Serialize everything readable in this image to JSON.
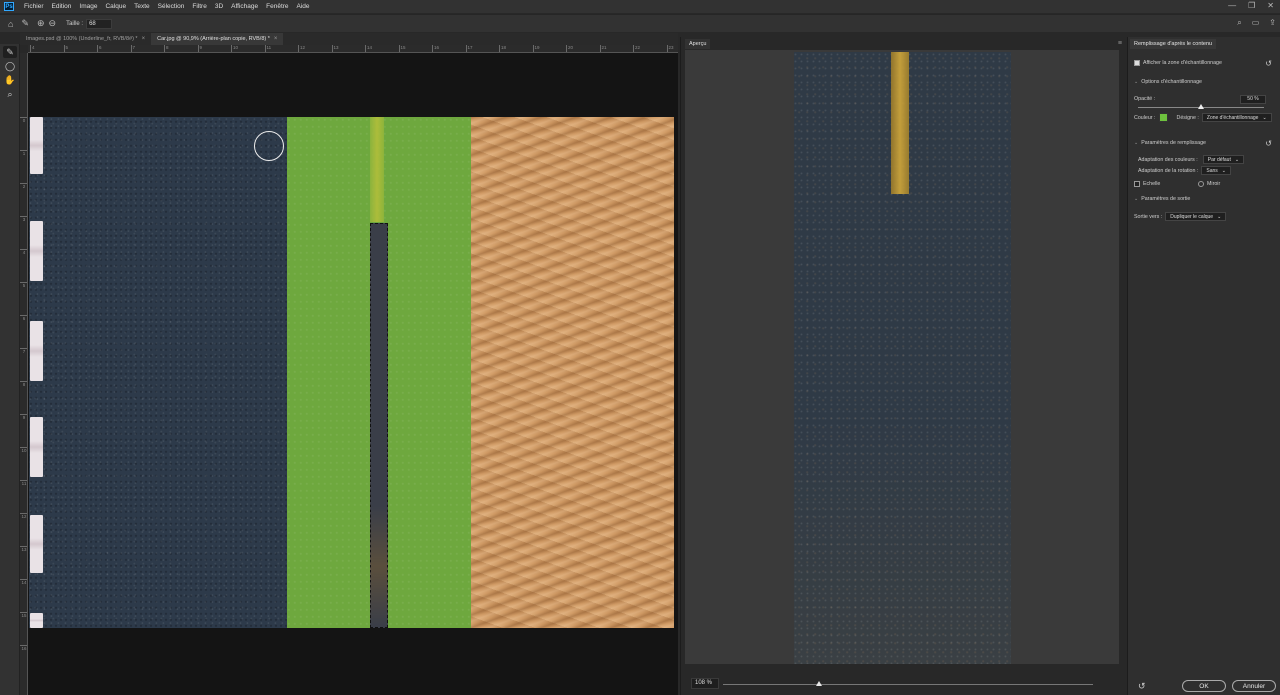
{
  "app": {
    "logo": "Ps"
  },
  "menu": [
    "Fichier",
    "Edition",
    "Image",
    "Calque",
    "Texte",
    "Sélection",
    "Filtre",
    "3D",
    "Affichage",
    "Fenêtre",
    "Aide"
  ],
  "window_controls": {
    "minimize": "—",
    "restore": "❐",
    "close": "✕"
  },
  "options": {
    "size_label": "Taille :",
    "size_value": "68"
  },
  "tools": [
    "brush-icon",
    "lasso-icon",
    "hand-icon",
    "zoom-icon"
  ],
  "tabs": [
    {
      "label": "Images.psd @ 100% (Underline_fr, RVB/8#) *",
      "close": "×",
      "active": false
    },
    {
      "label": "Car.jpg @ 90,9% (Arrière-plan copie, RVB/8) *",
      "close": "×",
      "active": true
    }
  ],
  "ruler_h": [
    "4",
    "5",
    "6",
    "7",
    "8",
    "9",
    "10",
    "11",
    "12",
    "13",
    "14",
    "15",
    "16",
    "17",
    "18",
    "19",
    "20",
    "21",
    "22",
    "23",
    "24",
    "25",
    "26"
  ],
  "ruler_v": [
    "0",
    "1",
    "2",
    "3",
    "4",
    "5",
    "6",
    "7",
    "8",
    "9",
    "10",
    "11",
    "12",
    "13",
    "14",
    "15",
    "16"
  ],
  "preview": {
    "tab": "Aperçu",
    "menu": "≡",
    "zoom": "108 %",
    "zoom_level": 0.26
  },
  "props": {
    "tab": "Remplissage d'après le contenu",
    "show_sampling": "Afficher la zone d'échantillonnage",
    "sampling_options": "Options d'échantillonnage",
    "opacity_label": "Opacité :",
    "opacity_value": "50 %",
    "opacity_level": 0.5,
    "color_label": "Couleur :",
    "color_hex": "#6ec23e",
    "designate_label": "Désigne :",
    "designate_value": "Zone d'échantillonnage",
    "fill_settings": "Paramètres de remplissage",
    "color_adapt_label": "Adaptation des couleurs :",
    "color_adapt_value": "Par défaut",
    "rotation_adapt_label": "Adaptation de la rotation :",
    "rotation_adapt_value": "Sans",
    "scale_label": "Echelle",
    "mirror_label": "Miroir",
    "output_settings": "Paramètres de sortie",
    "output_label": "Sortie vers :",
    "output_value": "Dupliquer le calque",
    "ok": "OK",
    "cancel": "Annuler"
  }
}
